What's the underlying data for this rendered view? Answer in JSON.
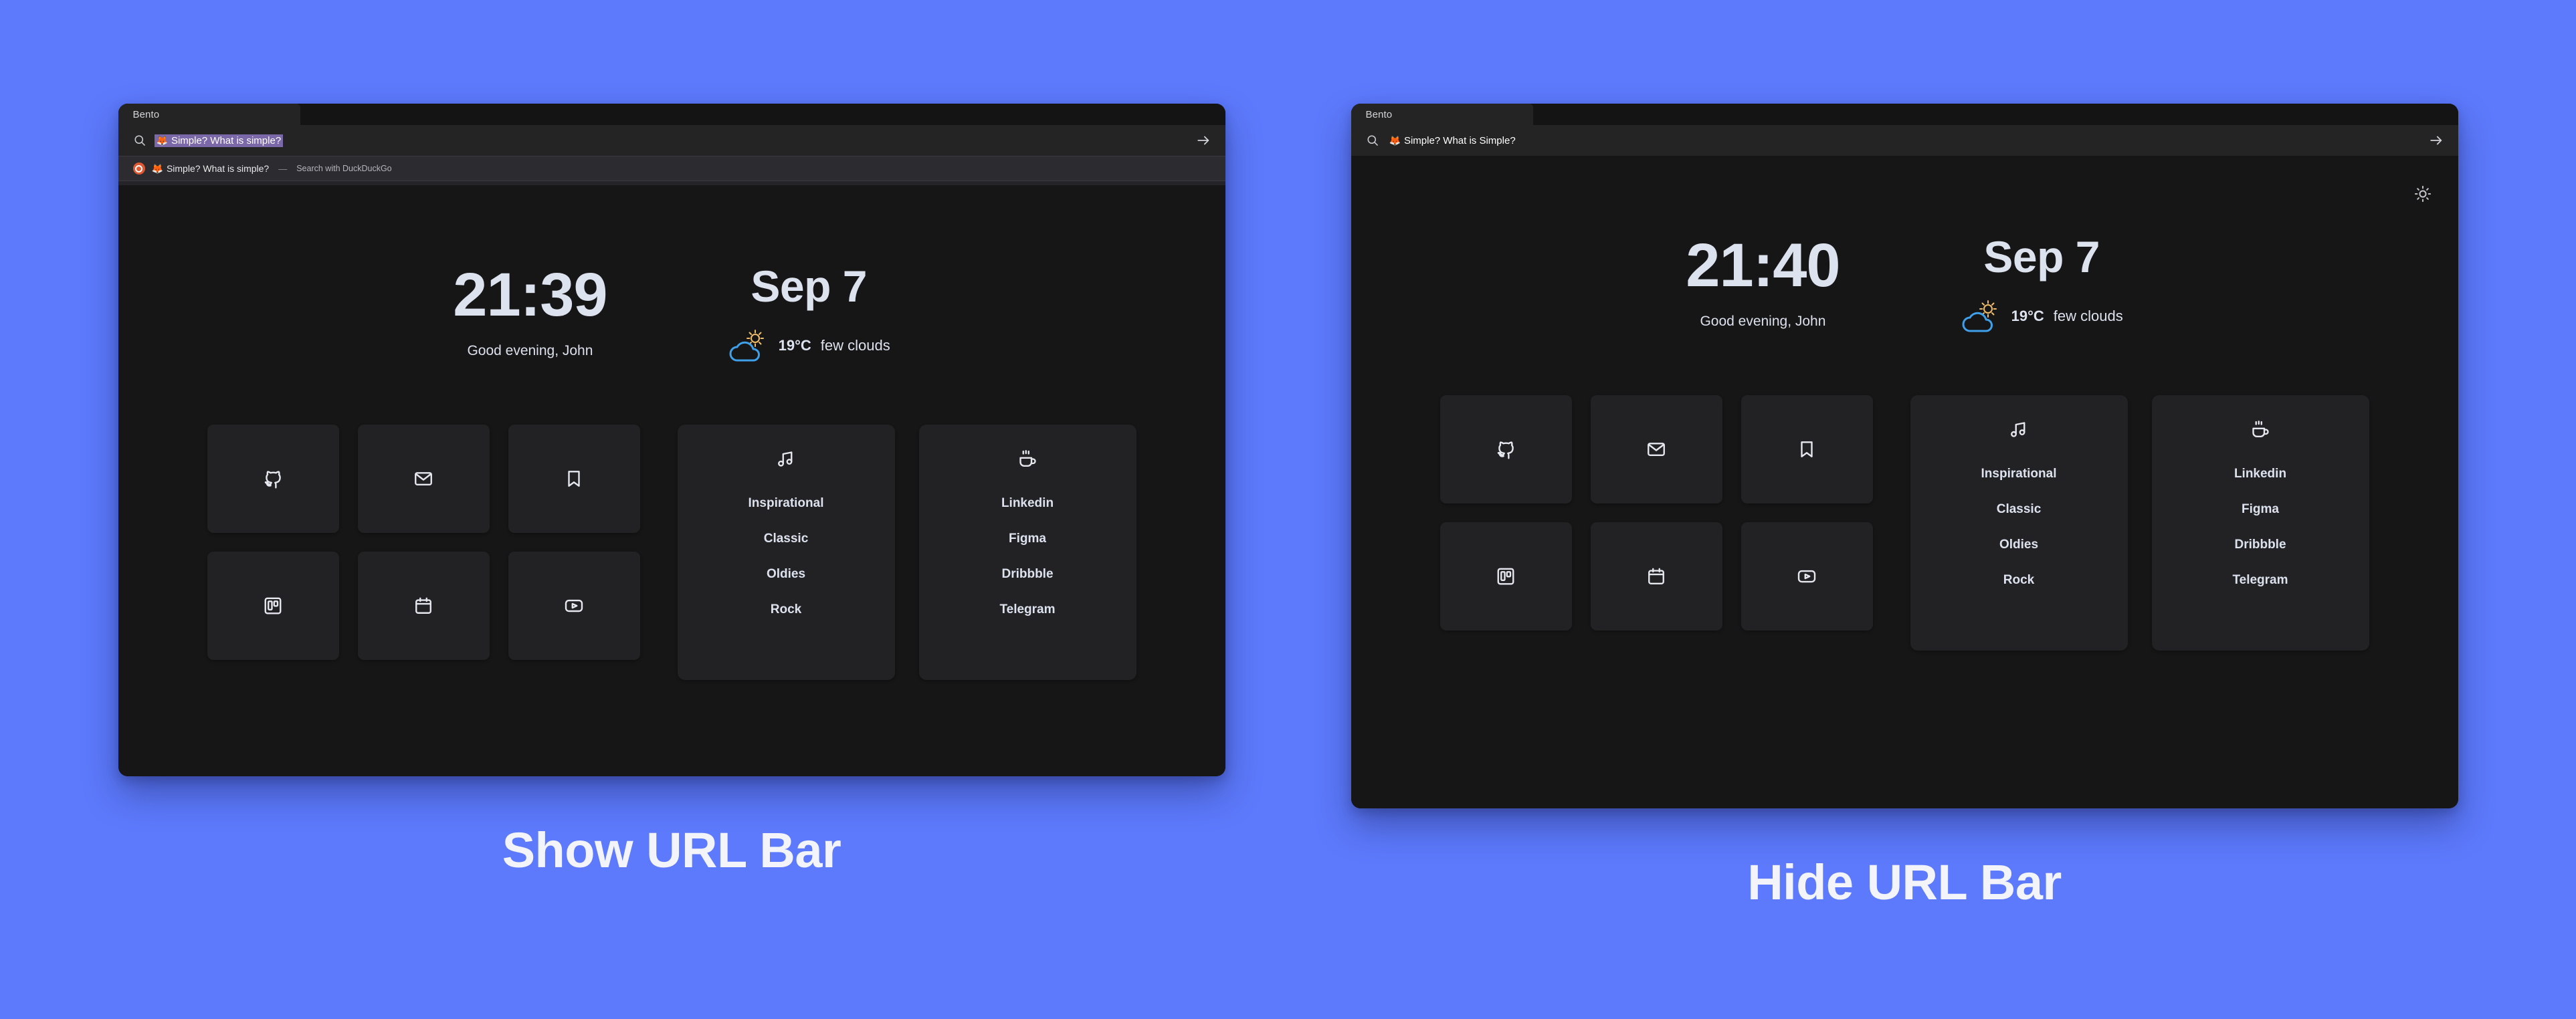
{
  "theme": {
    "page_background": "#5d7afc",
    "window_background": "#161616",
    "card_background": "#222224",
    "text_primary": "#dde2ef",
    "weather_cloud_color": "#3f9fe8",
    "weather_sun_color": "#f0bd6a",
    "url_selection_color": "#7b68a8"
  },
  "panels": [
    {
      "caption": "Show URL Bar",
      "url_bar_visible": true,
      "browser": {
        "tab_label": "Bento",
        "search_icon": "search-icon",
        "url_prefix_icon": "firefox-fox-icon",
        "url_value": "Simple? What is simple?",
        "url_value_selected": true,
        "go_icon": "arrow-right-icon",
        "suggestion": {
          "engine_icon": "duckduckgo-icon",
          "prefix_icon": "firefox-fox-icon",
          "query": "Simple? What is simple?",
          "dash": "—",
          "action": "Search with DuckDuckGo"
        }
      },
      "dashboard": {
        "theme_toggle_icon": "sun-icon",
        "theme_toggle_visible": false,
        "clock": "21:39",
        "greeting": "Good evening, John",
        "date": "Sep 7",
        "weather": {
          "icon": "sun-behind-cloud-icon",
          "temperature": "19°C",
          "condition": "few clouds"
        },
        "tiles": [
          {
            "icon": "github-icon"
          },
          {
            "icon": "mail-icon"
          },
          {
            "icon": "bookmark-icon"
          },
          {
            "icon": "trello-icon"
          },
          {
            "icon": "calendar-icon"
          },
          {
            "icon": "youtube-icon"
          }
        ],
        "cards": [
          {
            "icon": "music-note-icon",
            "items": [
              "Inspirational",
              "Classic",
              "Oldies",
              "Rock"
            ]
          },
          {
            "icon": "coffee-cup-icon",
            "items": [
              "Linkedin",
              "Figma",
              "Dribbble",
              "Telegram"
            ]
          }
        ]
      }
    },
    {
      "caption": "Hide URL Bar",
      "url_bar_visible": false,
      "browser": {
        "tab_label": "Bento",
        "search_icon": "search-icon",
        "url_prefix_icon": "firefox-fox-icon",
        "url_value": "Simple? What is Simple?",
        "url_value_selected": false,
        "go_icon": "arrow-right-icon",
        "suggestion": null
      },
      "dashboard": {
        "theme_toggle_icon": "sun-icon",
        "theme_toggle_visible": true,
        "clock": "21:40",
        "greeting": "Good evening, John",
        "date": "Sep 7",
        "weather": {
          "icon": "sun-behind-cloud-icon",
          "temperature": "19°C",
          "condition": "few clouds"
        },
        "tiles": [
          {
            "icon": "github-icon"
          },
          {
            "icon": "mail-icon"
          },
          {
            "icon": "bookmark-icon"
          },
          {
            "icon": "trello-icon"
          },
          {
            "icon": "calendar-icon"
          },
          {
            "icon": "youtube-icon"
          }
        ],
        "cards": [
          {
            "icon": "music-note-icon",
            "items": [
              "Inspirational",
              "Classic",
              "Oldies",
              "Rock"
            ]
          },
          {
            "icon": "coffee-cup-icon",
            "items": [
              "Linkedin",
              "Figma",
              "Dribbble",
              "Telegram"
            ]
          }
        ]
      }
    }
  ]
}
